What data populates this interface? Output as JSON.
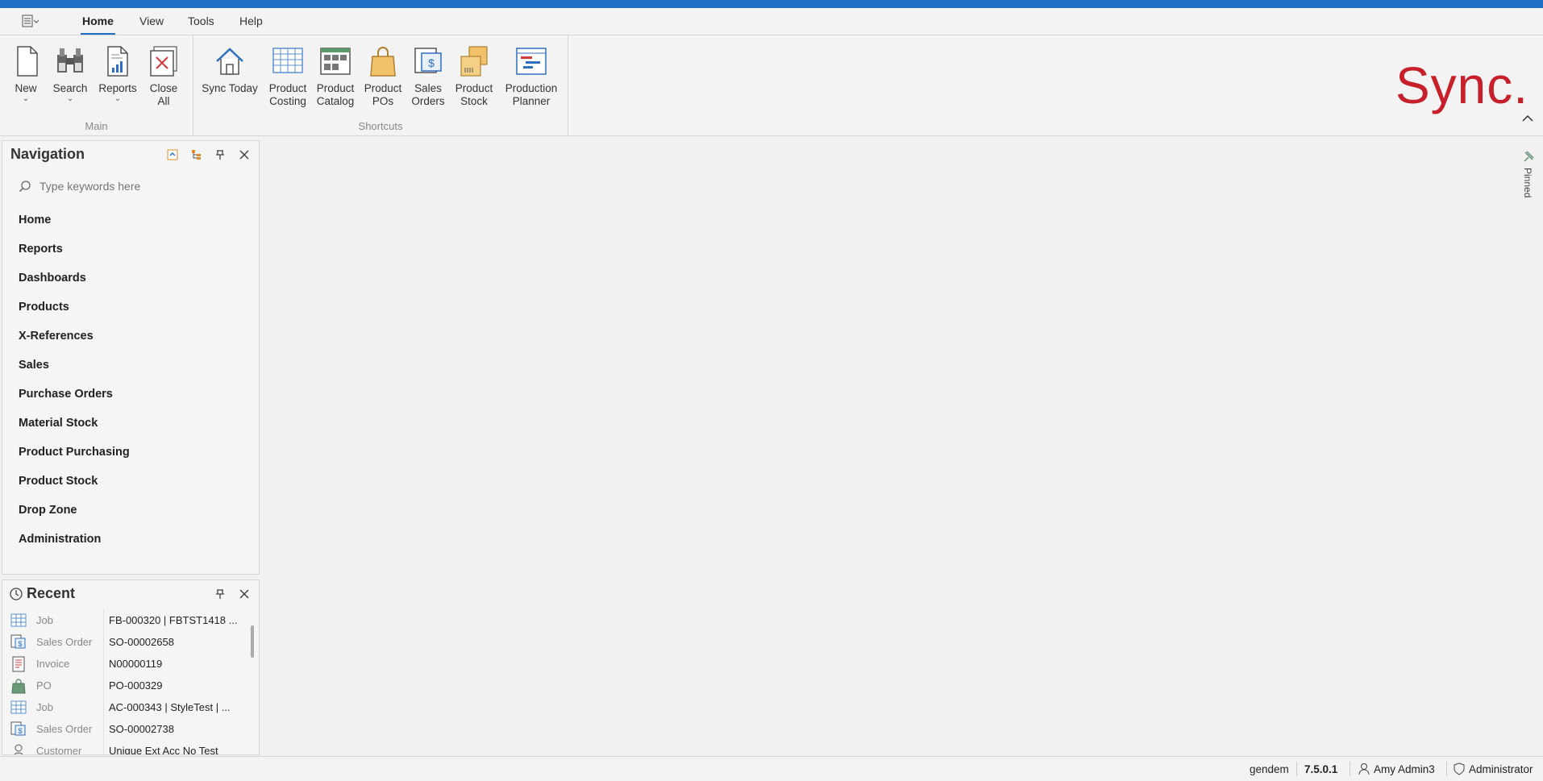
{
  "menu": {
    "tabs": [
      {
        "label": "Home",
        "active": true
      },
      {
        "label": "View"
      },
      {
        "label": "Tools"
      },
      {
        "label": "Help"
      }
    ]
  },
  "ribbon": {
    "main_group": {
      "label": "Main",
      "buttons": [
        {
          "label": "New",
          "icon": "new-document-icon",
          "dropdown": true
        },
        {
          "label": "Search",
          "icon": "binoculars-icon",
          "dropdown": true
        },
        {
          "label": "Reports",
          "icon": "report-icon",
          "dropdown": true
        },
        {
          "label": "Close All",
          "icon": "close-all-icon",
          "dropdown": false
        }
      ]
    },
    "shortcuts_group": {
      "label": "Shortcuts",
      "buttons": [
        {
          "label": "Sync Today",
          "icon": "home-icon"
        },
        {
          "label": "Product Costing",
          "icon": "grid-icon"
        },
        {
          "label": "Product Catalog",
          "icon": "catalog-icon"
        },
        {
          "label": "Product POs",
          "icon": "shopping-bag-icon"
        },
        {
          "label": "Sales Orders",
          "icon": "sales-orders-icon"
        },
        {
          "label": "Product Stock",
          "icon": "boxes-icon"
        },
        {
          "label": "Production Planner",
          "icon": "gantt-icon"
        }
      ]
    },
    "logo": "Sync."
  },
  "navigation": {
    "title": "Navigation",
    "search_placeholder": "Type keywords here",
    "items": [
      "Home",
      "Reports",
      "Dashboards",
      "Products",
      "X-References",
      "Sales",
      "Purchase Orders",
      "Material Stock",
      "Product Purchasing",
      "Product Stock",
      "Drop Zone",
      "Administration"
    ]
  },
  "recent": {
    "title": "Recent",
    "rows": [
      {
        "type": "Job",
        "value": "FB-000320 | FBTST1418 ...",
        "icon": "grid-icon"
      },
      {
        "type": "Sales Order",
        "value": "SO-00002658",
        "icon": "sales-orders-icon"
      },
      {
        "type": "Invoice",
        "value": "N00000119",
        "icon": "invoice-icon"
      },
      {
        "type": "PO",
        "value": "PO-000329",
        "icon": "shopping-bag-icon"
      },
      {
        "type": "Job",
        "value": "AC-000343 | StyleTest | ...",
        "icon": "grid-icon"
      },
      {
        "type": "Sales Order",
        "value": "SO-00002738",
        "icon": "sales-orders-icon"
      },
      {
        "type": "Customer",
        "value": "Unique Ext Acc No Test",
        "icon": "customer-icon"
      }
    ]
  },
  "pinned_label": "Pinned",
  "status": {
    "database": "gendem",
    "version": "7.5.0.1",
    "user": "Amy Admin3",
    "role": "Administrator"
  }
}
